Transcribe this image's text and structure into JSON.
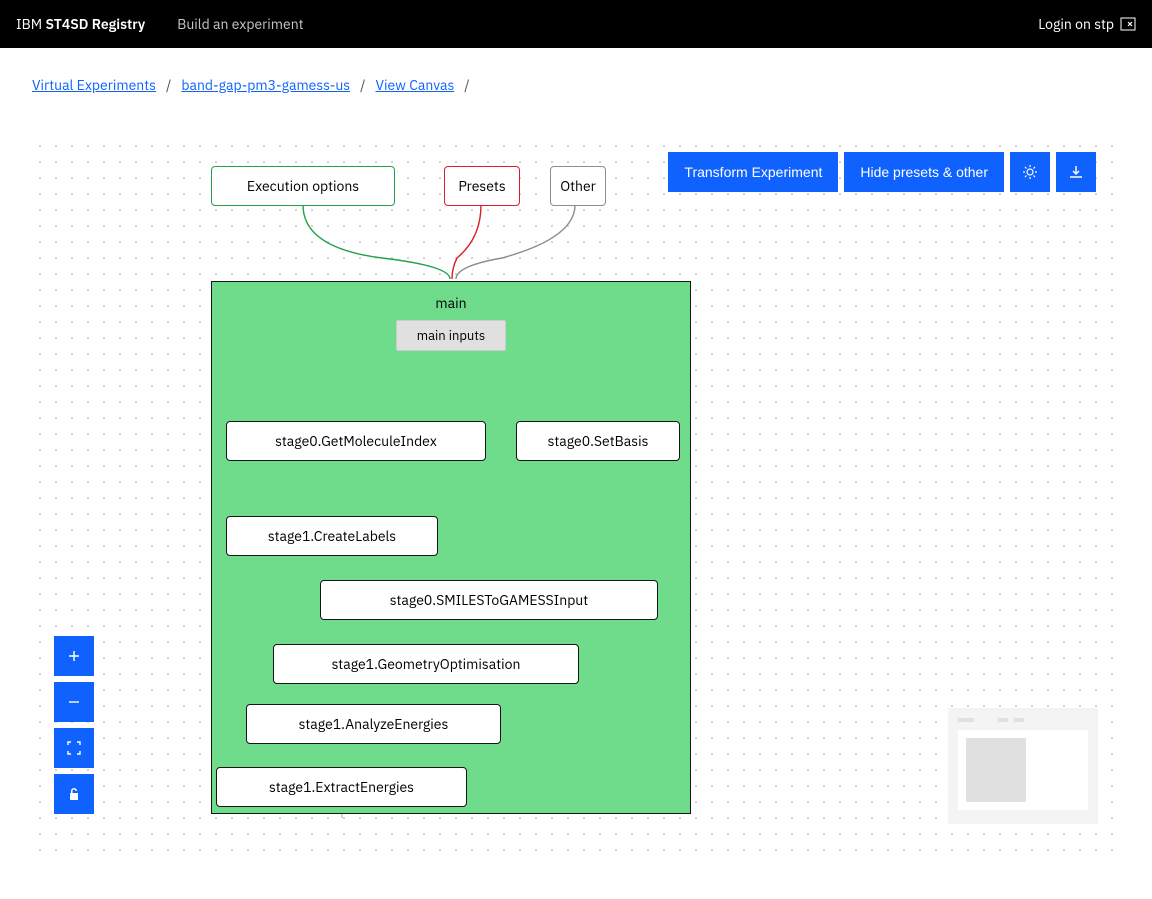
{
  "header": {
    "brand_prefix": "IBM",
    "brand_name": "ST4SD Registry",
    "nav_link": "Build an experiment",
    "login_text": "Login on stp"
  },
  "breadcrumbs": {
    "items": [
      "Virtual Experiments",
      "band-gap-pm3-gamess-us",
      "View Canvas"
    ]
  },
  "actions": {
    "transform": "Transform Experiment",
    "hide_presets": "Hide presets & other"
  },
  "graph": {
    "top_nodes": {
      "execution": "Execution options",
      "presets": "Presets",
      "other": "Other"
    },
    "main": {
      "title": "main",
      "inputs_label": "main inputs",
      "stages": {
        "get_molecule_index": "stage0.GetMoleculeIndex",
        "set_basis": "stage0.SetBasis",
        "create_labels": "stage1.CreateLabels",
        "smiles_to_gamess": "stage0.SMILESToGAMESSInput",
        "geometry_optimisation": "stage1.GeometryOptimisation",
        "analyze_energies": "stage1.AnalyzeEnergies",
        "extract_energies": "stage1.ExtractEnergies"
      }
    }
  }
}
